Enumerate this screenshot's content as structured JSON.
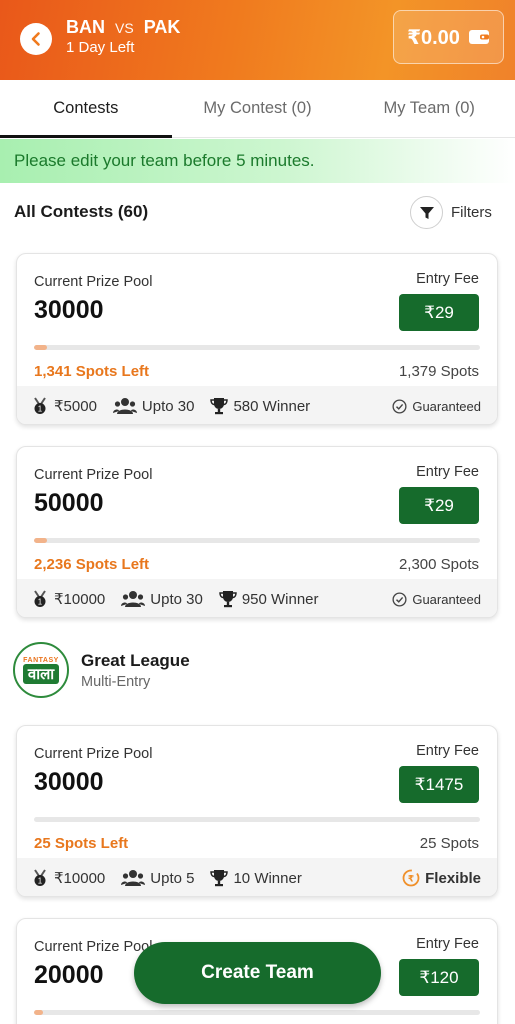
{
  "header": {
    "team1": "BAN",
    "vs": "VS",
    "team2": "PAK",
    "time_left": "1 Day Left",
    "wallet_balance": "₹0.00"
  },
  "tabs": [
    {
      "label": "Contests"
    },
    {
      "label": "My Contest (0)"
    },
    {
      "label": "My Team (0)"
    }
  ],
  "notice": "Please edit your team before 5 minutes.",
  "contests_header": {
    "title": "All Contests (60)",
    "filters_label": "Filters"
  },
  "cards": [
    {
      "prize_label": "Current Prize Pool",
      "prize": "30000",
      "fee_label": "Entry Fee",
      "fee": "₹29",
      "fill_fraction": 0.03,
      "spots_left": "1,341 Spots Left",
      "spots_total": "1,379 Spots",
      "first_prize": "₹5000",
      "upto": "Upto 30",
      "winners": "580 Winner",
      "tag": "Guaranteed"
    },
    {
      "prize_label": "Current Prize Pool",
      "prize": "50000",
      "fee_label": "Entry Fee",
      "fee": "₹29",
      "fill_fraction": 0.03,
      "spots_left": "2,236 Spots Left",
      "spots_total": "2,300 Spots",
      "first_prize": "₹10000",
      "upto": "Upto 30",
      "winners": "950 Winner",
      "tag": "Guaranteed"
    },
    {
      "prize_label": "Current Prize Pool",
      "prize": "30000",
      "fee_label": "Entry Fee",
      "fee": "₹1475",
      "fill_fraction": 0.0,
      "spots_left": "25 Spots Left",
      "spots_total": "25 Spots",
      "first_prize": "₹10000",
      "upto": "Upto 5",
      "winners": "10 Winner",
      "tag": "Flexible"
    },
    {
      "prize_label": "Current Prize Pool",
      "prize": "20000",
      "fee_label": "Entry Fee",
      "fee": "₹120",
      "fill_fraction": 0.02
    }
  ],
  "league": {
    "logo_top": "FANTASY",
    "logo_main": "वाला",
    "title": "Great League",
    "subtitle": "Multi-Entry"
  },
  "create_team": "Create Team",
  "colors": {
    "accent_green": "#166b2c",
    "accent_orange": "#e8771d",
    "header_orange": "#f07a1e"
  }
}
